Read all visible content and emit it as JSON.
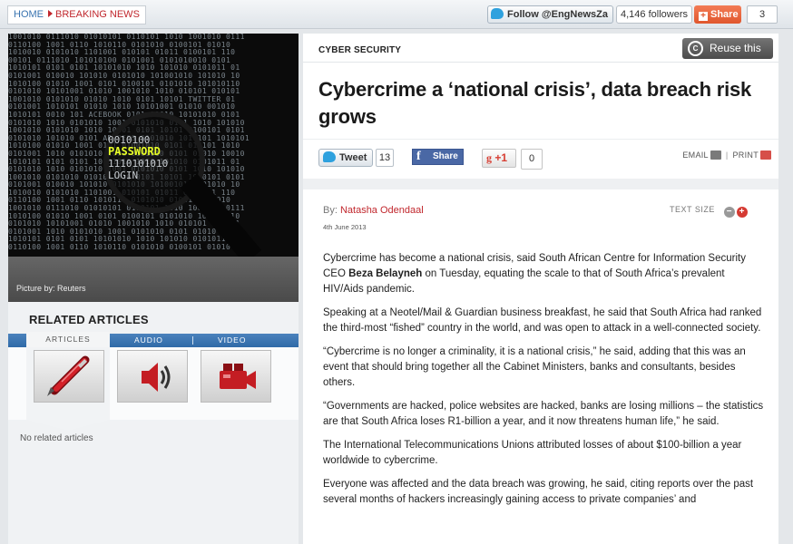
{
  "topbar": {
    "breadcrumb_home": "HOME",
    "breadcrumb_section": "BREAKING NEWS",
    "follow_label": "Follow @EngNewsZa",
    "followers_label": "4,146 followers",
    "share_label": "Share",
    "share_count": "3"
  },
  "photo": {
    "mag_line1": "0010100",
    "mag_password": "PASSWORD",
    "mag_line3": "1110101010",
    "mag_login": "LOGIN",
    "caption": "Picture by: Reuters"
  },
  "related": {
    "title": "RELATED ARTICLES",
    "tabs": [
      "ARTICLES",
      "AUDIO",
      "VIDEO"
    ],
    "empty_text": "No related articles"
  },
  "article": {
    "category": "CYBER SECURITY",
    "reuse_label": "Reuse this",
    "headline": "Cybercrime a ‘national crisis’, data breach risk grows",
    "tweet_label": "Tweet",
    "tweet_count": "13",
    "fb_share_label": "Share",
    "gplus_label": "+1",
    "gplus_count": "0",
    "email_label": "EMAIL",
    "print_label": "PRINT",
    "byline_prefix": "By: ",
    "author": "Natasha Odendaal",
    "date": "4th June 2013",
    "text_size_label": "TEXT SIZE",
    "p1_a": "Cybercrime has become a national crisis, said South African Centre for Information Security CEO ",
    "p1_name": "Beza Belayneh",
    "p1_b": " on Tuesday, equating the scale to that of South Africa’s prevalent HIV/Aids pandemic.",
    "p2": "Speaking at a Neotel/Mail & Guardian business breakfast, he said that South Africa had ranked the third-most “fished” country in the world, and was open to attack in a well-connected society.",
    "p3": "“Cybercrime is no longer a criminality, it is a national crisis,” he said, adding that this was an event that should bring together all the Cabinet Ministers, banks and consultants, besides others.",
    "p4": "“Governments are hacked, police websites are hacked, banks are losing millions – the statistics are that South Africa loses R1-billion a year, and it now threatens human life,” he said.",
    "p5": "The International Telecommunications Unions attributed losses of about $100-billion a year worldwide to cybercrime.",
    "p6": "Everyone was affected and the data breach was growing, he said, citing reports over the past several months of hackers increasingly gaining access to private companies’ and"
  }
}
